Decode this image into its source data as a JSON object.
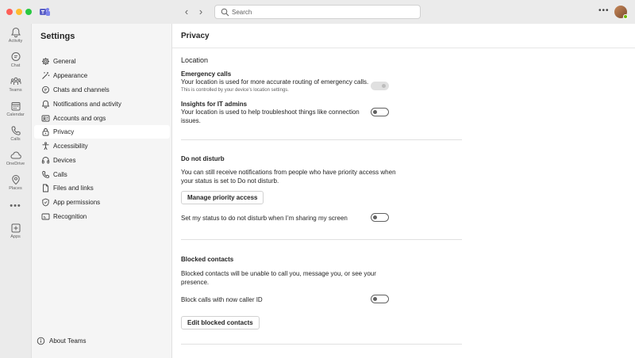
{
  "titlebar": {
    "search_placeholder": "Search"
  },
  "rail": {
    "items": [
      {
        "label": "Activity",
        "icon": "bell-icon"
      },
      {
        "label": "Chat",
        "icon": "chat-icon"
      },
      {
        "label": "Teams",
        "icon": "teams-icon"
      },
      {
        "label": "Calendar",
        "icon": "calendar-icon"
      },
      {
        "label": "Calls",
        "icon": "phone-icon"
      },
      {
        "label": "OneDrive",
        "icon": "cloud-icon"
      },
      {
        "label": "Places",
        "icon": "places-icon"
      },
      {
        "label": "Apps",
        "icon": "apps-icon"
      }
    ]
  },
  "sidebar": {
    "title": "Settings",
    "items": [
      {
        "label": "General",
        "icon": "gear-icon"
      },
      {
        "label": "Appearance",
        "icon": "wand-icon"
      },
      {
        "label": "Chats and channels",
        "icon": "chat-icon"
      },
      {
        "label": "Notifications and activity",
        "icon": "bell-icon"
      },
      {
        "label": "Accounts and orgs",
        "icon": "person-card-icon"
      },
      {
        "label": "Privacy",
        "icon": "lock-icon",
        "active": true
      },
      {
        "label": "Accessibility",
        "icon": "accessibility-icon"
      },
      {
        "label": "Devices",
        "icon": "headset-icon"
      },
      {
        "label": "Calls",
        "icon": "phone-icon"
      },
      {
        "label": "Files and links",
        "icon": "document-icon"
      },
      {
        "label": "App permissions",
        "icon": "shield-icon"
      },
      {
        "label": "Recognition",
        "icon": "recognition-icon"
      }
    ],
    "about": "About Teams"
  },
  "main": {
    "title": "Privacy",
    "location": {
      "heading": "Location",
      "emergency_title": "Emergency calls",
      "emergency_desc": "Your location is used for more accurate routing of emergency calls.",
      "emergency_note": "This is controlled by your device’s location settings.",
      "emergency_toggle": "on-disabled",
      "insights_title": "Insights for IT admins",
      "insights_desc_1": "Your location is used to help troubleshoot things like connection",
      "insights_desc_2": "issues.",
      "insights_toggle": "off"
    },
    "dnd": {
      "heading": "Do not disturb",
      "desc_1": "You can still receive notifications from people who have priority access when",
      "desc_2": "your status is set to Do not disturb.",
      "button": "Manage priority access",
      "sharing_label": "Set my status to do not disturb when I’m sharing my screen",
      "sharing_toggle": "off"
    },
    "blocked": {
      "heading": "Blocked contacts",
      "desc_1": "Blocked contacts will be unable to call you, message you, or see your",
      "desc_2": "presence.",
      "block_calls_label": "Block calls with now caller ID",
      "block_calls_toggle": "off",
      "button": "Edit blocked contacts"
    }
  }
}
